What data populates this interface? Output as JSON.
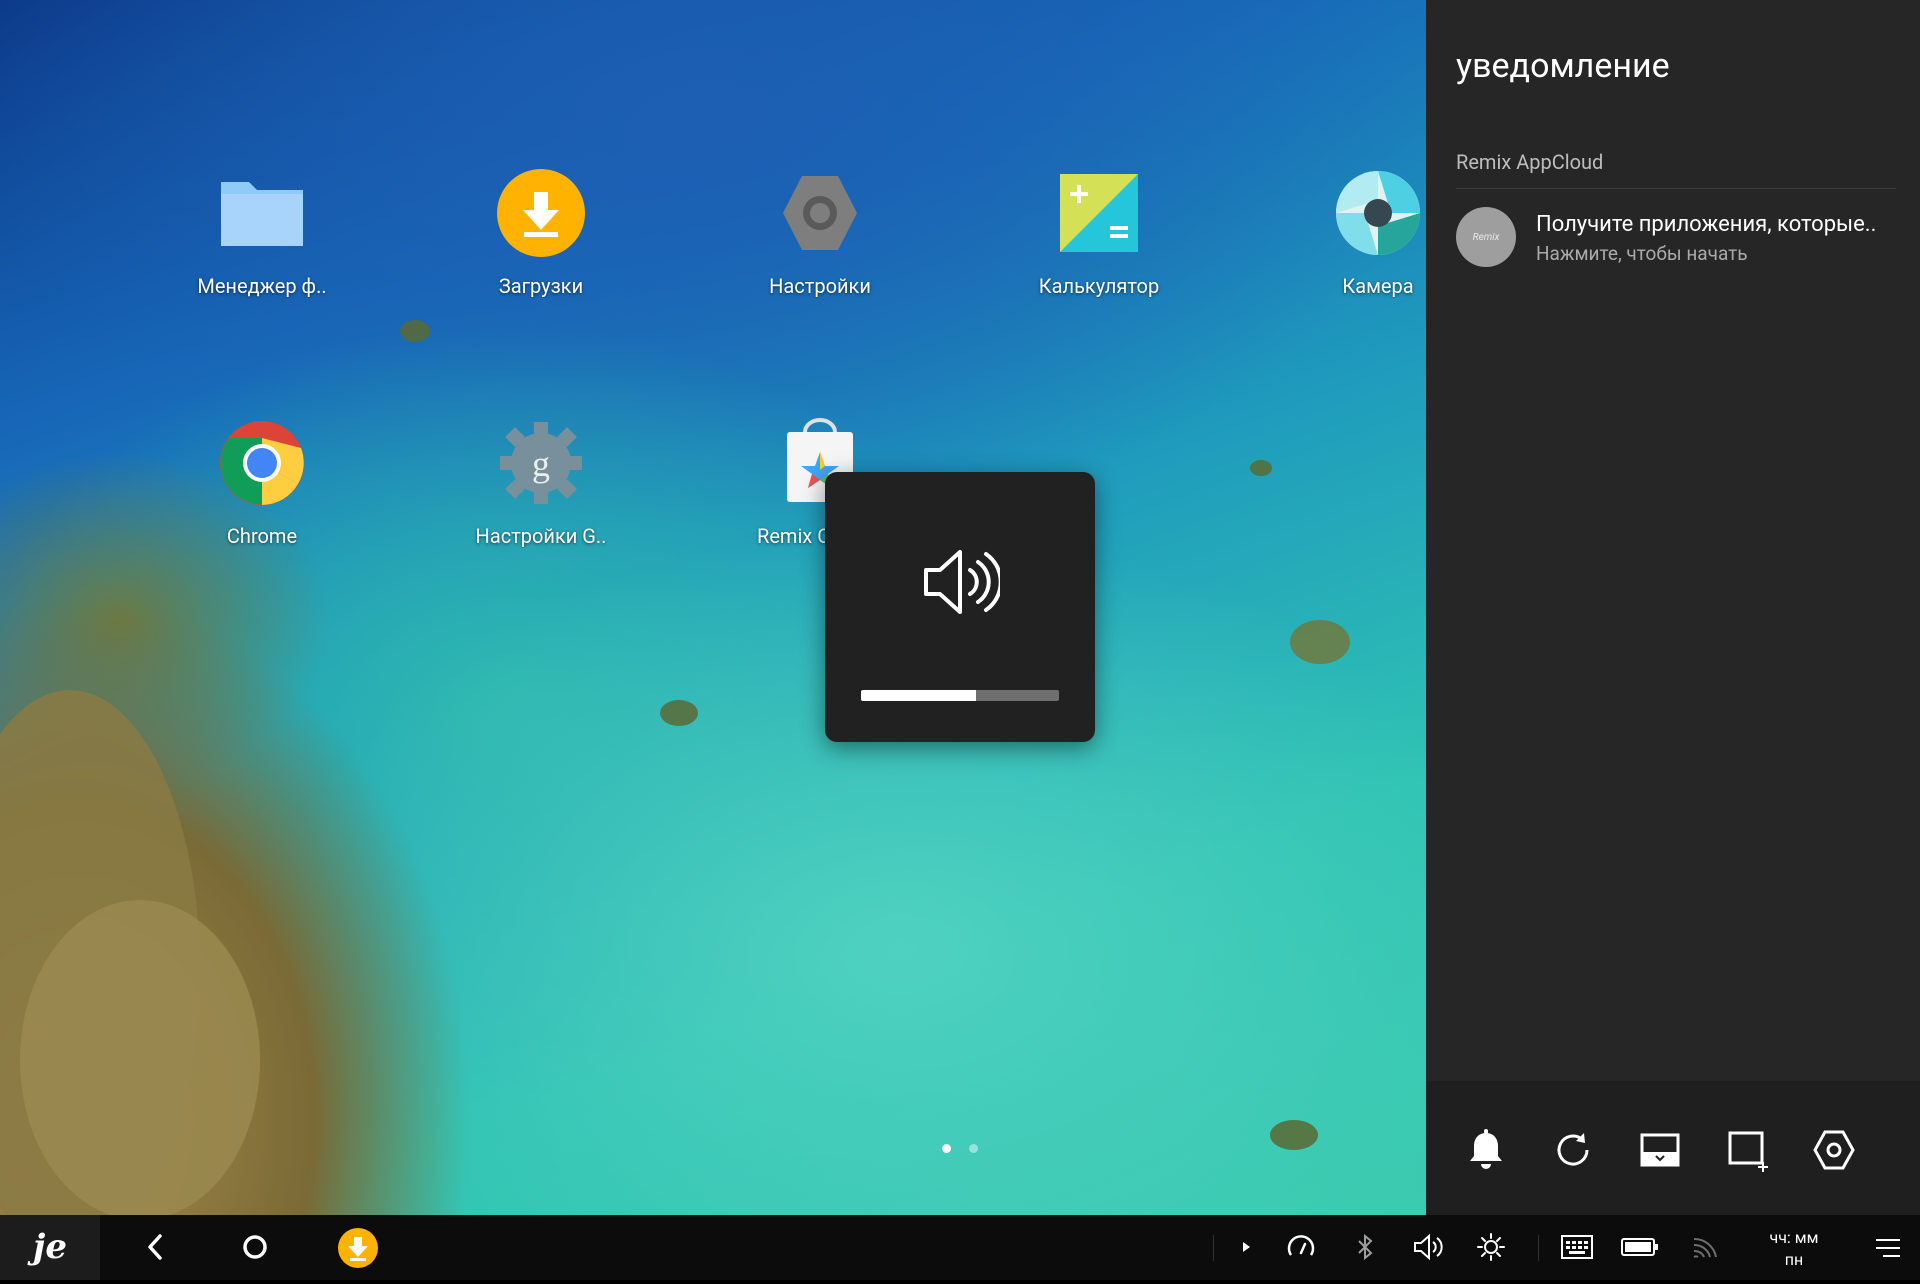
{
  "apps": [
    {
      "label": "Менеджер ф..",
      "icon": "folder-icon"
    },
    {
      "label": "Загрузки",
      "icon": "download-icon"
    },
    {
      "label": "Настройки",
      "icon": "settings-icon"
    },
    {
      "label": "Калькулятор",
      "icon": "calculator-icon"
    },
    {
      "label": "Камера",
      "icon": "camera-icon"
    },
    {
      "label": "Chrome",
      "icon": "chrome-icon"
    },
    {
      "label": "Настройки G..",
      "icon": "google-settings-icon"
    },
    {
      "label": "Remix C",
      "icon": "remix-store-icon"
    }
  ],
  "pages": {
    "total": 2,
    "active": 1
  },
  "volume": {
    "level_percent": 58,
    "icon": "speaker-icon"
  },
  "notifications": {
    "title": "уведомление",
    "groups": [
      {
        "app": "Remix AppCloud",
        "items": [
          {
            "avatar_text": "Remix",
            "title": "Получите приложения, которые..",
            "subtitle": "Нажмите, чтобы начать"
          }
        ]
      }
    ],
    "quick_actions": [
      "bell-icon",
      "refresh-icon",
      "screenshot-icon",
      "screen-crop-icon",
      "settings-hex-icon"
    ]
  },
  "taskbar": {
    "left": [
      "remix-logo-icon",
      "back-icon",
      "home-icon",
      "download-app-icon"
    ],
    "tray": [
      "expand-arrow-icon",
      "speedometer-icon",
      "bluetooth-icon",
      "volume-icon",
      "brightness-icon",
      "keyboard-icon",
      "battery-icon",
      "wifi-icon"
    ],
    "clock_time": "чч: мм",
    "clock_day": "пн",
    "menu": "hamburger-icon"
  },
  "colors": {
    "accent_orange": "#FFB300",
    "panel_bg": "#262626",
    "taskbar_bg": "#0c0c0c"
  }
}
